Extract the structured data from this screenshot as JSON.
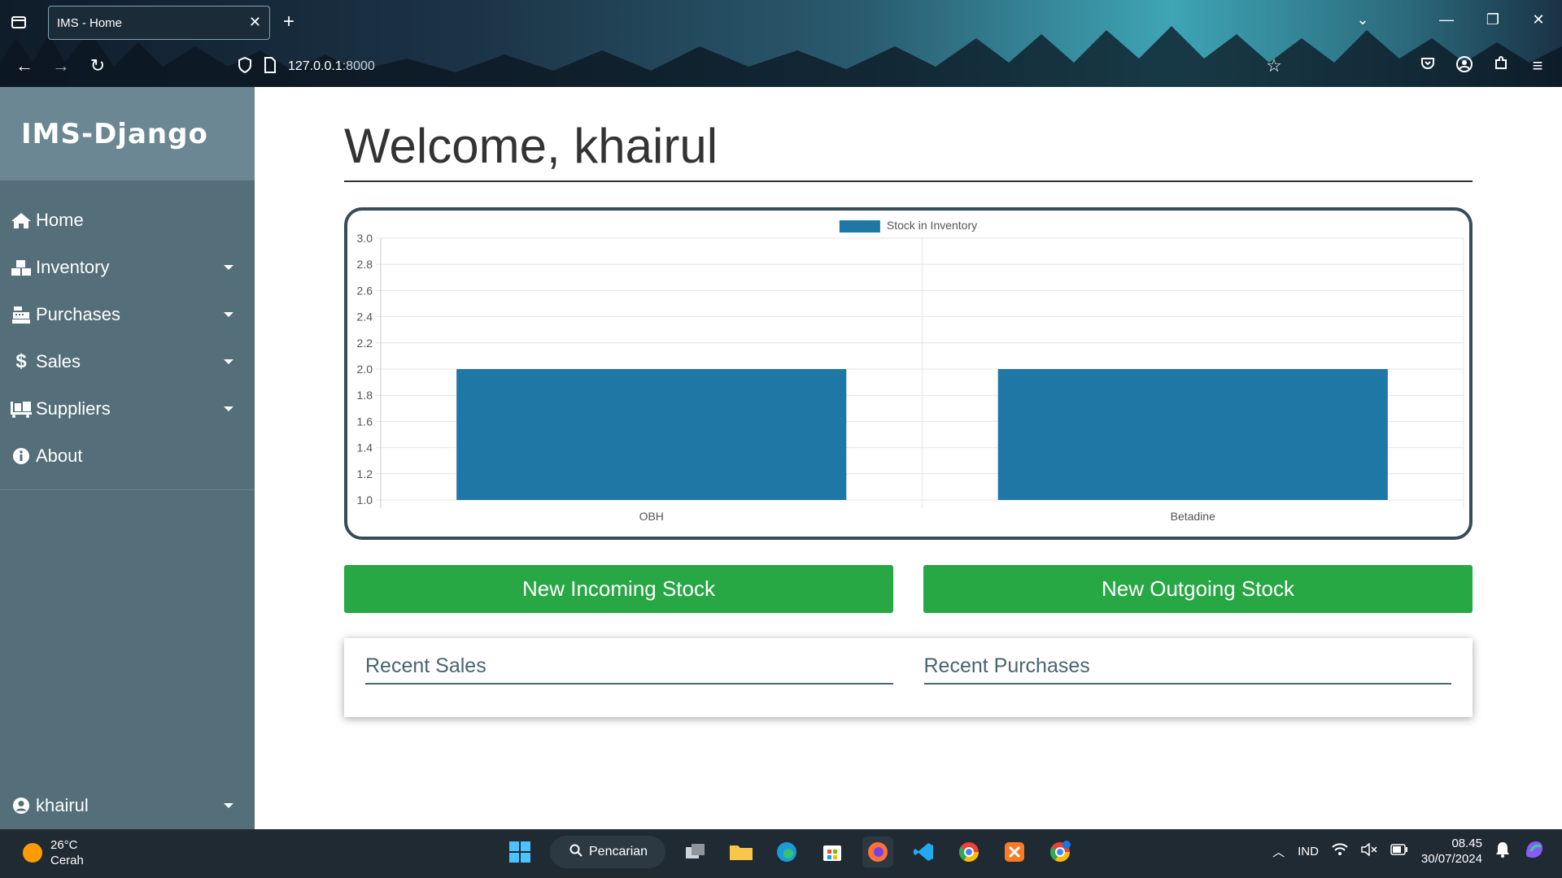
{
  "browser": {
    "tab_title": "IMS - Home",
    "url_host": "127.0.0.1",
    "url_port": ":8000"
  },
  "sidebar": {
    "brand": "IMS-Django",
    "items": [
      {
        "label": "Home",
        "icon": "home-icon",
        "has_caret": false
      },
      {
        "label": "Inventory",
        "icon": "boxes-icon",
        "has_caret": true
      },
      {
        "label": "Purchases",
        "icon": "cash-register-icon",
        "has_caret": true
      },
      {
        "label": "Sales",
        "icon": "dollar-icon",
        "has_caret": true
      },
      {
        "label": "Suppliers",
        "icon": "truck-loading-icon",
        "has_caret": true
      },
      {
        "label": "About",
        "icon": "info-circle-icon",
        "has_caret": false
      }
    ],
    "user": "khairul"
  },
  "main": {
    "welcome": "Welcome, khairul",
    "incoming_button": "New Incoming Stock",
    "outgoing_button": "New Outgoing Stock",
    "recent_sales": "Recent Sales",
    "recent_purchases": "Recent Purchases"
  },
  "chart_data": {
    "type": "bar",
    "categories": [
      "OBH",
      "Betadine"
    ],
    "series": [
      {
        "name": "Stock in Inventory",
        "values": [
          2,
          2
        ],
        "color": "#1f77a6"
      }
    ],
    "ylim": [
      1.0,
      3.0
    ],
    "yticks": [
      "1.0",
      "1.2",
      "1.4",
      "1.6",
      "1.8",
      "2.0",
      "2.2",
      "2.4",
      "2.6",
      "2.8",
      "3.0"
    ],
    "legend": "top"
  },
  "taskbar": {
    "temperature": "26°C",
    "weather": "Cerah",
    "search": "Pencarian",
    "language": "IND",
    "time": "08.45",
    "date": "30/07/2024"
  },
  "colors": {
    "sidebar": "#546e7a",
    "brand_bg": "#6b8793",
    "button_green": "#28a745",
    "bar": "#1f77a6"
  }
}
